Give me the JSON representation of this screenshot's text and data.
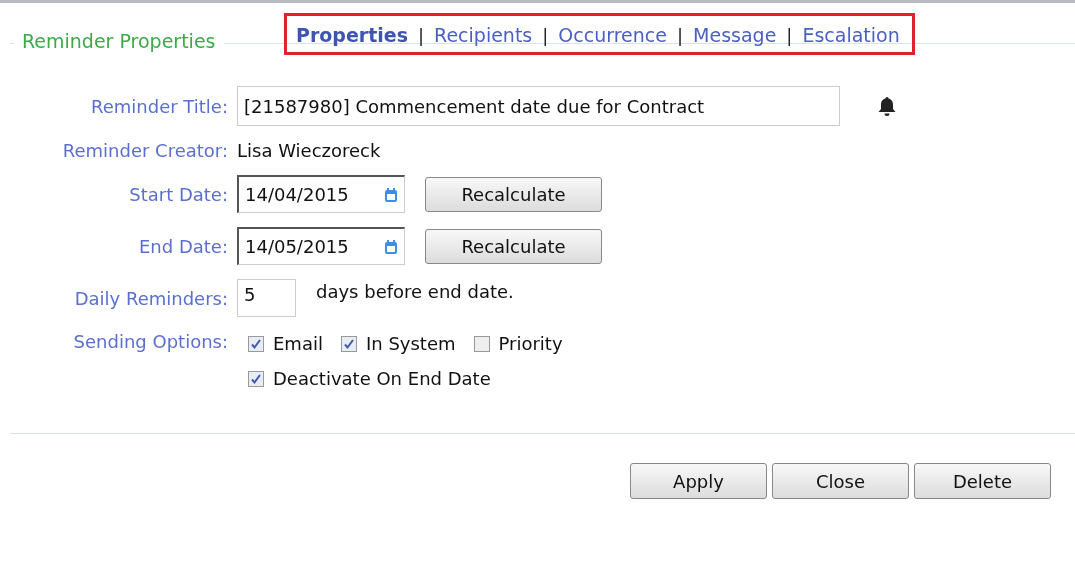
{
  "nav": {
    "highlighted": true,
    "items": [
      {
        "kind": "tab",
        "label": "Properties",
        "selected": true
      },
      {
        "kind": "separator",
        "label": "|"
      },
      {
        "kind": "tab",
        "label": "Recipients",
        "selected": false
      },
      {
        "kind": "separator",
        "label": "|"
      },
      {
        "kind": "tab",
        "label": "Occurrence",
        "selected": false
      },
      {
        "kind": "separator",
        "label": "|"
      },
      {
        "kind": "tab",
        "label": "Message",
        "selected": false
      },
      {
        "kind": "separator",
        "label": "|"
      },
      {
        "kind": "tab",
        "label": "Escalation",
        "selected": false
      }
    ]
  },
  "section": {
    "legend": "Reminder Properties"
  },
  "title": {
    "label": "Reminder Title:",
    "value": "[21587980] Commencement date due for Contract"
  },
  "creator": {
    "label": "Reminder Creator:",
    "value": "Lisa Wieczoreck"
  },
  "dates": [
    {
      "label": "Start Date:",
      "value": "14/04/2015",
      "button": "Recalculate"
    },
    {
      "label": "End Date:",
      "value": "14/05/2015",
      "button": "Recalculate"
    }
  ],
  "daily": {
    "label": "Daily Reminders:",
    "value": "5",
    "suffix": "days before end date."
  },
  "sending": {
    "label": "Sending Options:",
    "rows": [
      [
        {
          "label": "Email",
          "checked": true
        },
        {
          "label": "In System",
          "checked": true
        },
        {
          "label": "Priority",
          "checked": false
        }
      ],
      [
        {
          "label": "Deactivate On End Date",
          "checked": true
        }
      ]
    ]
  },
  "buttons": [
    "Apply",
    "Close",
    "Delete"
  ]
}
